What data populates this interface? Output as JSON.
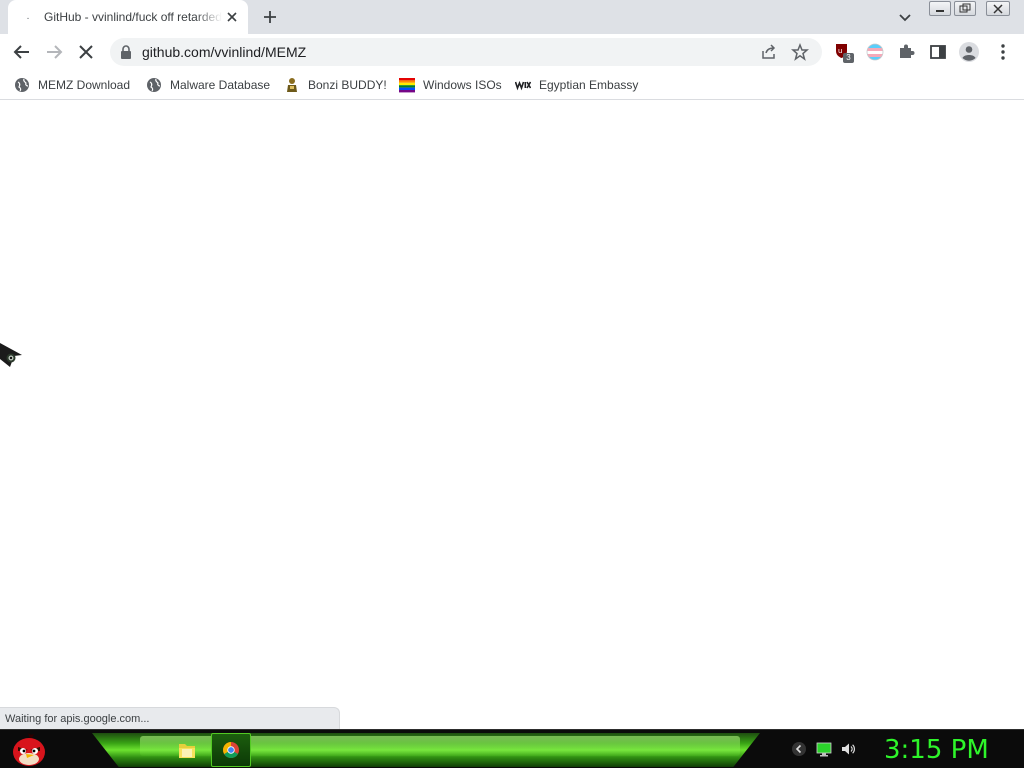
{
  "browser": {
    "tab": {
      "title": "GitHub - vvinlind/fuck off retarded",
      "favicon_text": ".",
      "loading": true
    },
    "toolbar": {
      "url": "github.com/vvinlind/MEMZ",
      "state": "loading"
    },
    "extensions": [
      {
        "icon": "ublock-icon",
        "badge": "3"
      },
      {
        "icon": "trans-flag-icon"
      },
      {
        "icon": "puzzle-icon"
      },
      {
        "icon": "side-panel-icon"
      },
      {
        "icon": "profile-icon"
      },
      {
        "icon": "kebab-menu-icon"
      }
    ],
    "bookmarks": [
      {
        "label": "MEMZ Download",
        "icon": "globe-icon"
      },
      {
        "label": "Malware Database",
        "icon": "globe-icon"
      },
      {
        "label": "Bonzi BUDDY!",
        "icon": "bonzi-icon"
      },
      {
        "label": "Windows ISOs",
        "icon": "rainbow-flag-icon"
      },
      {
        "label": "Egyptian Embassy",
        "icon": "wix-icon"
      }
    ],
    "status_bar": "Waiting for apis.google.com..."
  },
  "taskbar": {
    "apps": [
      {
        "icon": "folder-icon",
        "active": false
      },
      {
        "icon": "chrome-icon",
        "active": true
      }
    ],
    "tray": [
      "expand-icon",
      "monitor-icon",
      "volume-icon"
    ],
    "clock": "3:15 PM",
    "accent_color": "#2ef52a"
  }
}
